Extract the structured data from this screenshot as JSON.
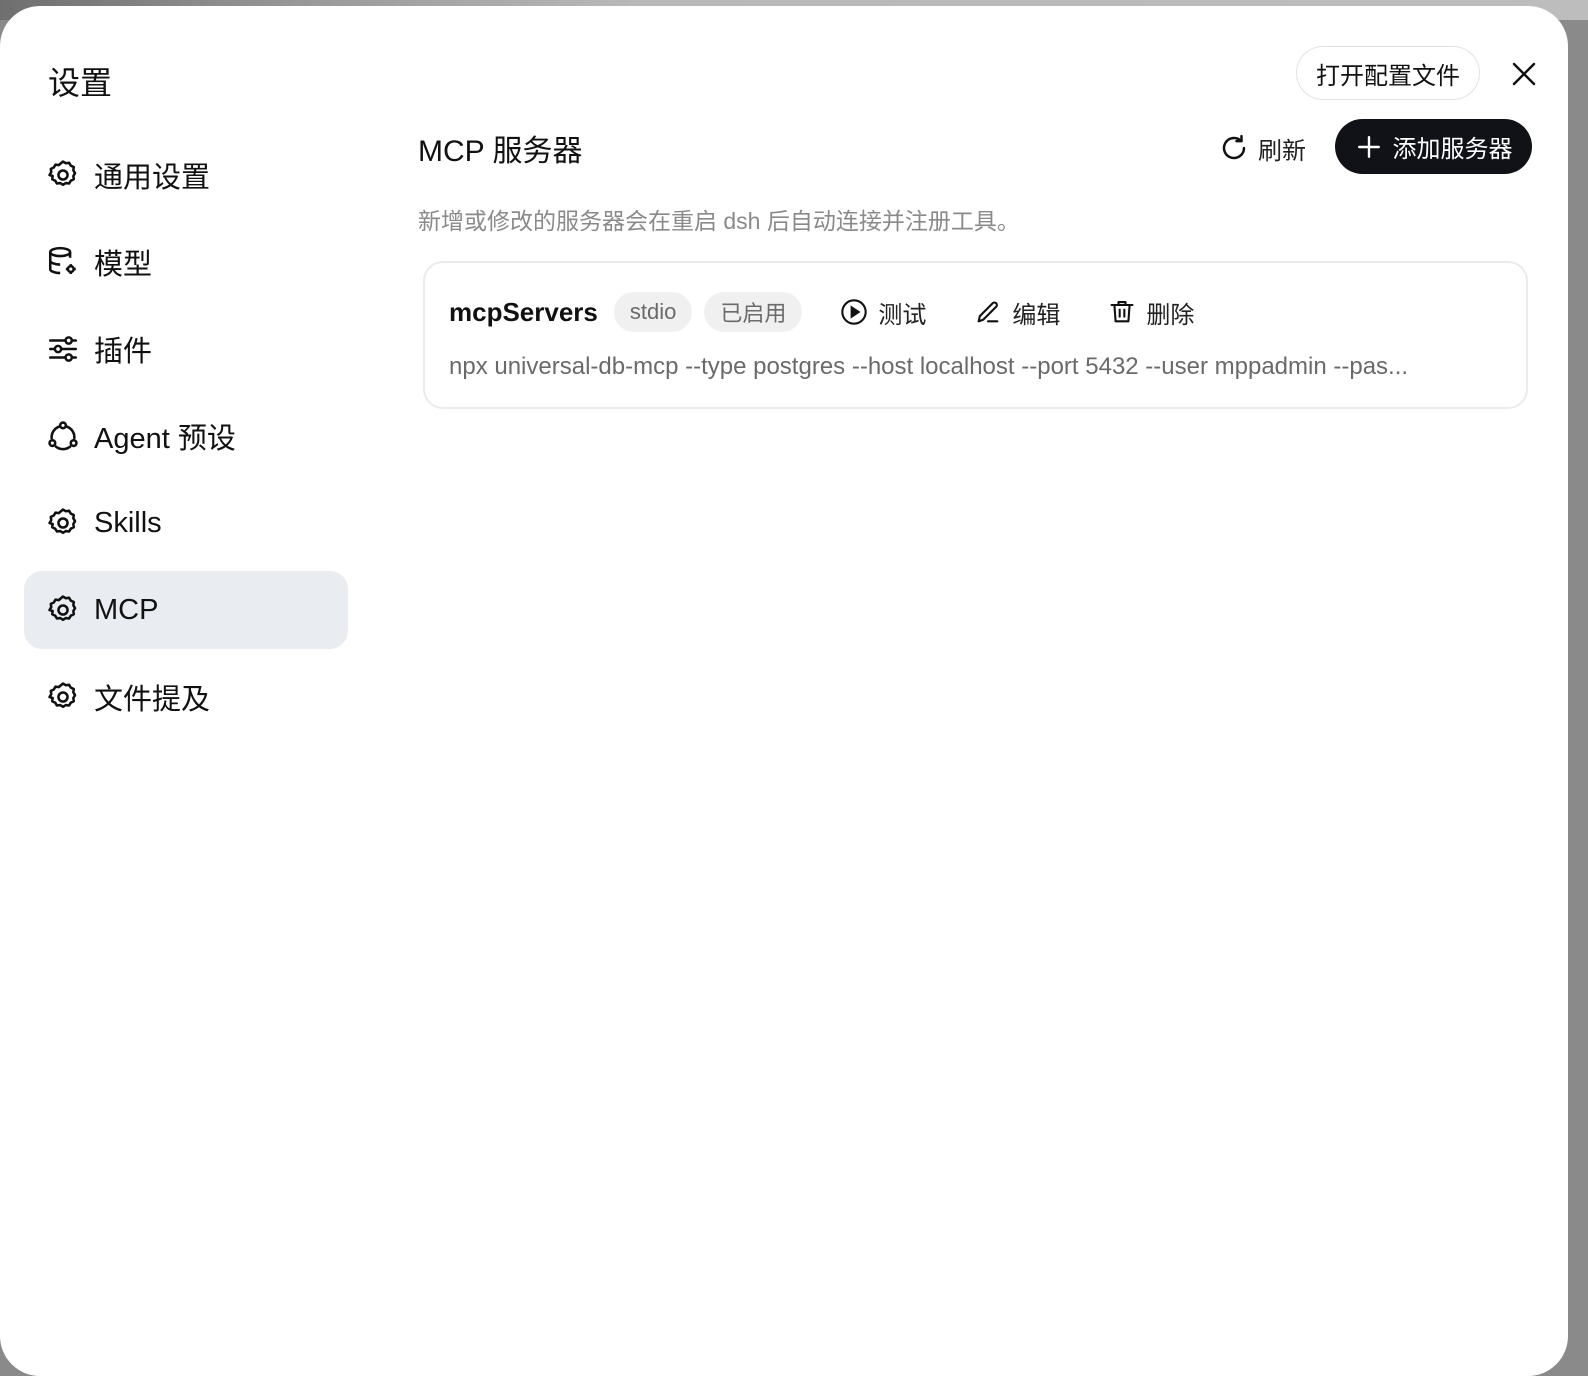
{
  "dialog": {
    "title": "设置",
    "open_config_label": "打开配置文件",
    "close_icon": "close-icon"
  },
  "sidebar": {
    "items": [
      {
        "label": "通用设置",
        "icon": "gear-icon",
        "active": false
      },
      {
        "label": "模型",
        "icon": "database-gear-icon",
        "active": false
      },
      {
        "label": "插件",
        "icon": "sliders-icon",
        "active": false
      },
      {
        "label": "Agent 预设",
        "icon": "workflow-icon",
        "active": false
      },
      {
        "label": "Skills",
        "icon": "gear-icon",
        "active": false
      },
      {
        "label": "MCP",
        "icon": "gear-icon",
        "active": true
      },
      {
        "label": "文件提及",
        "icon": "gear-icon",
        "active": false
      }
    ]
  },
  "main": {
    "title": "MCP 服务器",
    "refresh_label": "刷新",
    "add_label": "添加服务器",
    "description": "新增或修改的服务器会在重启 dsh 后自动连接并注册工具。",
    "servers": [
      {
        "name": "mcpServers",
        "transport": "stdio",
        "status": "已启用",
        "test_label": "测试",
        "edit_label": "编辑",
        "delete_label": "删除",
        "command": "npx universal-db-mcp --type postgres --host localhost --port 5432 --user mppadmin --pas..."
      }
    ]
  },
  "colors": {
    "active_nav_bg": "#e9ecf0",
    "primary_button_bg": "#101217",
    "muted_text": "#8a8a8a"
  }
}
